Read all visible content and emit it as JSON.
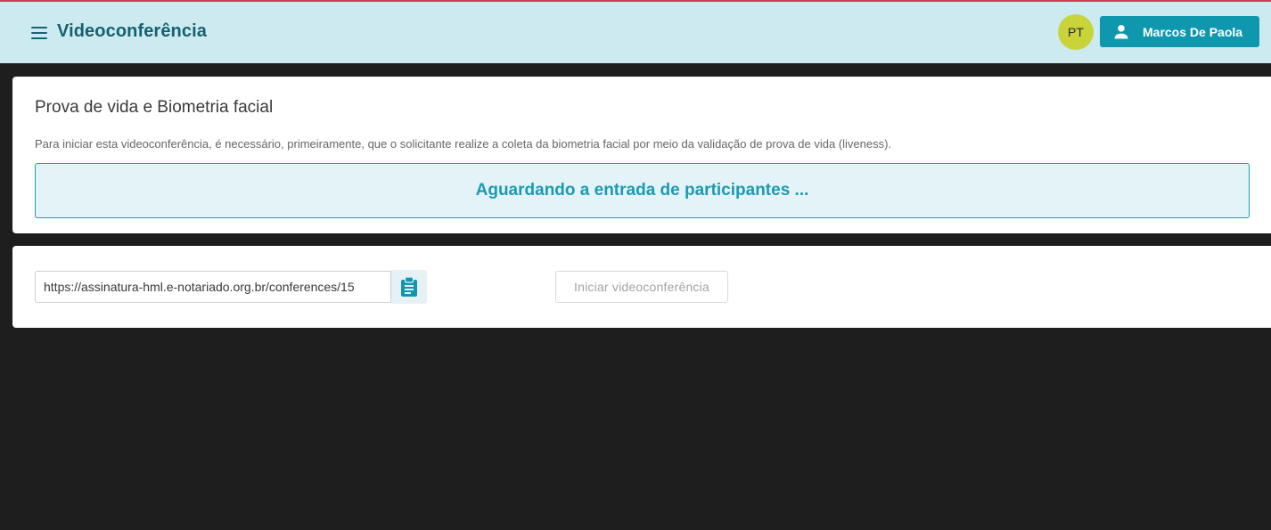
{
  "header": {
    "title": "Videoconferência",
    "avatar_initials": "PT",
    "user_name": "Marcos De Paola",
    "menu_icon": "hamburger-icon",
    "user_icon": "person-icon"
  },
  "biometria": {
    "title": "Prova de vida e Biometria facial",
    "description": "Para iniciar esta videoconferência, é necessário, primeiramente, que o solicitante realize a coleta da biometria facial por meio da validação de prova de vida (liveness).",
    "status": "Aguardando a entrada de participantes ..."
  },
  "conference": {
    "url_value": "https://assinatura-hml.e-notariado.org.br/conferences/15",
    "copy_icon": "clipboard-icon",
    "start_label": "Iniciar videoconferência",
    "start_disabled": true
  },
  "colors": {
    "header_bg": "#cdeaf0",
    "accent": "#0f97ad",
    "title_text": "#146170",
    "avatar_bg": "#c9d43a",
    "page_bg": "#1e1e1e",
    "top_line": "#d33a52"
  }
}
